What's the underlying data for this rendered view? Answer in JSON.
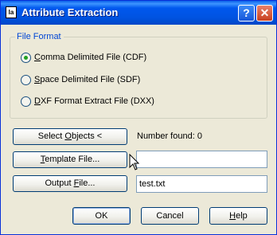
{
  "window": {
    "title": "Attribute Extraction",
    "app_icon": "autocad-dialog-icon",
    "help_glyph": "?",
    "close_glyph": "✕"
  },
  "file_format": {
    "legend": "File Format",
    "options": [
      {
        "label_ul": "C",
        "label_rest": "omma Delimited File (CDF)",
        "selected": true
      },
      {
        "label_ul": "S",
        "label_rest": "pace Delimited File (SDF)",
        "selected": false
      },
      {
        "label_ul": "D",
        "label_rest": "XF Format Extract File (DXX)",
        "selected": false
      }
    ]
  },
  "select_objects": {
    "label_pre": "Select ",
    "label_ul": "O",
    "label_post": "bjects <"
  },
  "number_found": {
    "label": "Number found:",
    "value": "0"
  },
  "template_file": {
    "label_ul": "T",
    "label_post": "emplate File...",
    "value": ""
  },
  "output_file": {
    "label_pre": "Output ",
    "label_ul": "F",
    "label_post": "ile...",
    "value": "test.txt"
  },
  "buttons": {
    "ok": "OK",
    "cancel": "Cancel",
    "help_ul": "H",
    "help_rest": "elp"
  },
  "colors": {
    "title_bar": "#0054e3",
    "dialog_bg": "#ece9d8",
    "legend_text": "#0046d5",
    "radio_dot": "#21a121",
    "close_button": "#d24a2a"
  }
}
